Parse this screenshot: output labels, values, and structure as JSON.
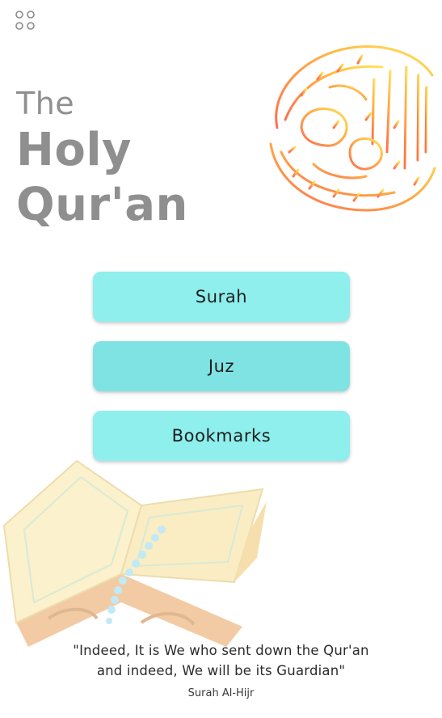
{
  "header": {
    "menu_icon": "grid-dots-icon"
  },
  "title": {
    "line1": "The",
    "line2": "Holy",
    "line3": "Qur'an"
  },
  "decor": {
    "calligraphy": "quran-calligraphy-logo",
    "book": "open-quran-on-stand-illustration"
  },
  "buttons": [
    {
      "label": "Surah"
    },
    {
      "label": "Juz"
    },
    {
      "label": "Bookmarks"
    }
  ],
  "quote": {
    "text": "\"Indeed, It is We who sent down the Qur'an and indeed, We will be its Guardian\"",
    "source": "Surah Al-Hijr"
  },
  "colors": {
    "button": "#8eefed",
    "button_active": "#7fe3e3",
    "title": "#8f8f8f",
    "calligraphy_start": "#ff6f4f",
    "calligraphy_end": "#ffd54a"
  }
}
